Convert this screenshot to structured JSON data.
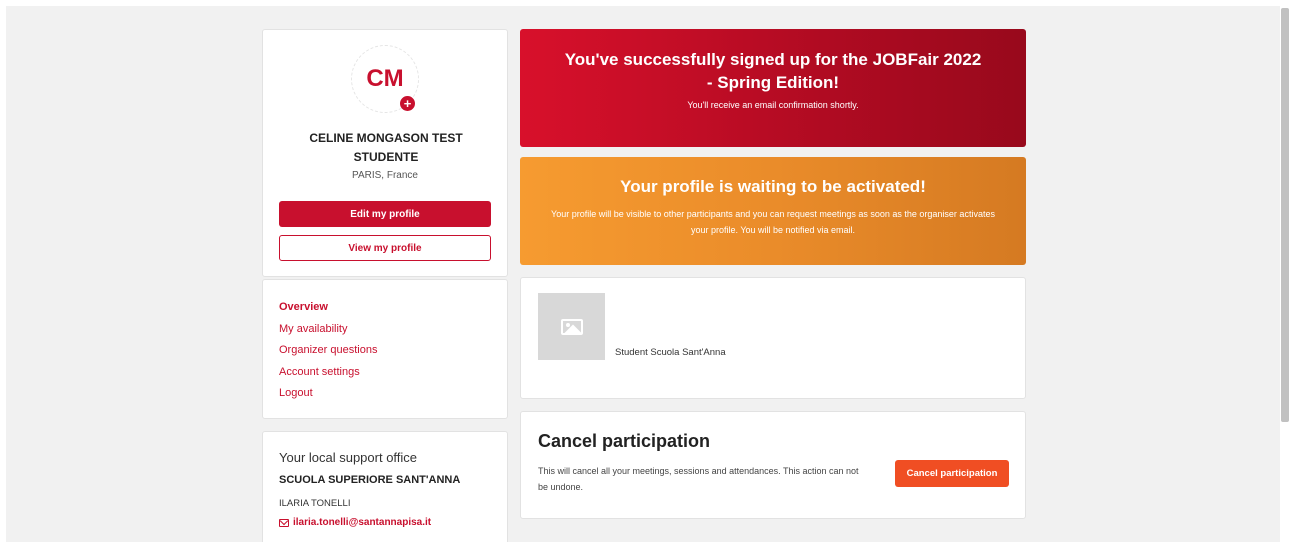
{
  "profile": {
    "initials": "CM",
    "add_badge": "+",
    "name": "CELINE MONGASON TEST STUDENTE",
    "location": "PARIS, France",
    "edit_label": "Edit my profile",
    "view_label": "View my profile"
  },
  "nav": {
    "items": [
      {
        "label": "Overview",
        "active": true
      },
      {
        "label": "My availability"
      },
      {
        "label": "Organizer questions"
      },
      {
        "label": "Account settings"
      },
      {
        "label": "Logout"
      }
    ]
  },
  "support": {
    "title": "Your local support office",
    "organization": "SCUOLA SUPERIORE SANT'ANNA",
    "contact": "ILARIA TONELLI",
    "email": "ilaria.tonelli@santannapisa.it"
  },
  "success_banner": {
    "title": "You've successfully signed up for the JOBFair 2022 - Spring Edition!",
    "subtitle": "You'll receive an email confirmation shortly.",
    "color": "#c8102e"
  },
  "activation_banner": {
    "title": "Your profile is waiting to be activated!",
    "text": "Your profile will be visible to other participants and you can request meetings as soon as the organiser activates your profile. You will be notified via email.",
    "color": "#ee902c"
  },
  "organization_card": {
    "image_icon": "image-placeholder-icon",
    "label": "Student Scuola Sant'Anna"
  },
  "cancel": {
    "title": "Cancel participation",
    "text": "This will cancel all your meetings, sessions and attendances. This action can not be undone.",
    "button_label": "Cancel participation",
    "button_color": "#f04e23"
  },
  "colors": {
    "accent": "#c8102e",
    "background": "#f1f1f1"
  }
}
